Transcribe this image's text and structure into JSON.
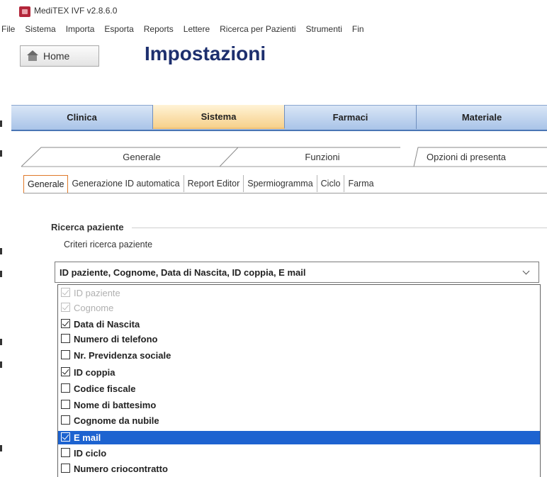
{
  "window": {
    "title": "MediTEX IVF v2.8.6.0"
  },
  "menu": [
    "File",
    "Sistema",
    "Importa",
    "Esporta",
    "Reports",
    "Lettere",
    "Ricerca per Pazienti",
    "Strumenti",
    "Fin"
  ],
  "home_label": "Home",
  "page_title": "Impostazioni",
  "main_tabs": [
    {
      "label": "Clinica",
      "active": false
    },
    {
      "label": "Sistema",
      "active": true
    },
    {
      "label": "Farmaci",
      "active": false
    },
    {
      "label": "Materiale",
      "active": false
    }
  ],
  "sub_tabs": [
    {
      "label": "Generale",
      "active": true
    },
    {
      "label": "Funzioni",
      "active": false
    },
    {
      "label": "Opzioni di presenta",
      "active": false
    }
  ],
  "section_tabs": [
    {
      "label": "Generale",
      "active": true
    },
    {
      "label": "Generazione ID automatica",
      "active": false
    },
    {
      "label": "Report Editor",
      "active": false
    },
    {
      "label": "Spermiogramma",
      "active": false
    },
    {
      "label": "Ciclo",
      "active": false
    },
    {
      "label": "Farma",
      "active": false
    }
  ],
  "group": {
    "title": "Ricerca paziente",
    "field_label": "Criteri ricerca paziente",
    "combo_value": "ID paziente, Cognome, Data di Nascita, ID coppia, E mail"
  },
  "options": [
    {
      "label": "ID paziente",
      "checked": true,
      "disabled": true,
      "selected": false
    },
    {
      "label": "Cognome",
      "checked": true,
      "disabled": true,
      "selected": false
    },
    {
      "label": "Data di Nascita",
      "checked": true,
      "disabled": false,
      "selected": false
    },
    {
      "label": "Numero di telefono",
      "checked": false,
      "disabled": false,
      "selected": false
    },
    {
      "label": "Nr. Previdenza sociale",
      "checked": false,
      "disabled": false,
      "selected": false
    },
    {
      "label": "ID coppia",
      "checked": true,
      "disabled": false,
      "selected": false
    },
    {
      "label": "Codice fiscale",
      "checked": false,
      "disabled": false,
      "selected": false
    },
    {
      "label": "Nome di battesimo",
      "checked": false,
      "disabled": false,
      "selected": false
    },
    {
      "label": "Cognome da nubile",
      "checked": false,
      "disabled": false,
      "selected": false
    },
    {
      "label": "E mail",
      "checked": true,
      "disabled": false,
      "selected": true
    },
    {
      "label": "ID ciclo",
      "checked": false,
      "disabled": false,
      "selected": false
    },
    {
      "label": "Numero criocontratto",
      "checked": false,
      "disabled": false,
      "selected": false
    }
  ],
  "colors": {
    "title": "#1d2f6e",
    "tab_active": "#f7d18c",
    "tab_bar": "#a9c4e8",
    "selection": "#1d63d0"
  }
}
